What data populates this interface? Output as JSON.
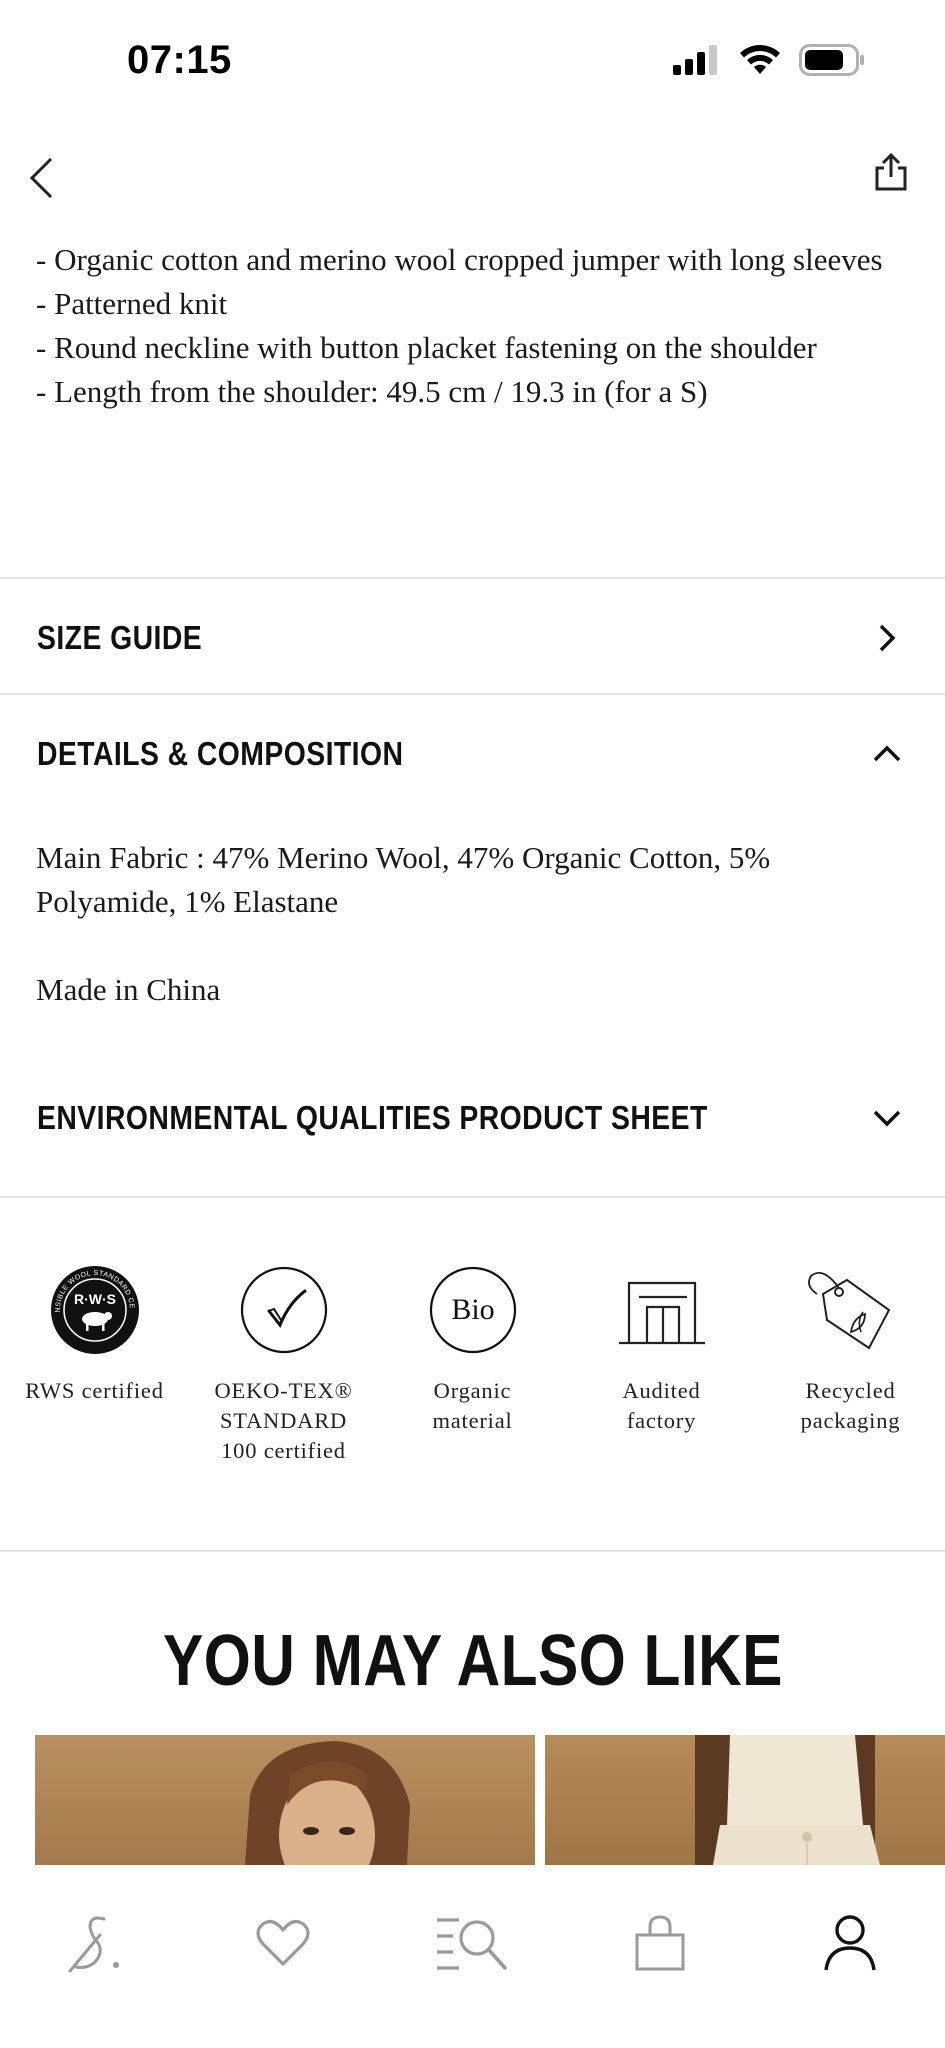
{
  "status_bar": {
    "time": "07:15",
    "icons": [
      "signal-icon",
      "wifi-icon",
      "battery-icon"
    ]
  },
  "nav": {
    "back_icon": "chevron-left-icon",
    "share_icon": "share-icon"
  },
  "description": {
    "lines": [
      "- Organic cotton and merino wool cropped jumper with long sleeves",
      "- Patterned knit",
      "- Round neckline with button placket fastening on the shoulder",
      "- Length from the shoulder: 49.5 cm / 19.3 in (for a S)"
    ]
  },
  "accordion": {
    "size_guide": "SIZE GUIDE",
    "details": "DETAILS & COMPOSITION",
    "environmental": "ENVIRONMENTAL QUALITIES PRODUCT SHEET"
  },
  "composition": {
    "fabric": "Main Fabric : 47% Merino Wool, 47% Organic Cotton, 5% Polyamide, 1% Elastane",
    "origin": "Made in China"
  },
  "badges": [
    {
      "icon": "rws-badge-icon",
      "label": "RWS certified",
      "emblem_text": "R·W·S",
      "ring_text": "RESPONSIBLE WOOL STANDARD CERTIFIED"
    },
    {
      "icon": "checkmark-circle-icon",
      "label": "OEKO-TEX®\nSTANDARD\n100 certified"
    },
    {
      "icon": "bio-circle-icon",
      "label": "Organic\nmaterial",
      "emblem_text": "Bio"
    },
    {
      "icon": "factory-icon",
      "label": "Audited\nfactory"
    },
    {
      "icon": "recycled-tag-icon",
      "label": "Recycled\npackaging"
    }
  ],
  "recommendations": {
    "title": "YOU MAY ALSO LIKE"
  },
  "tab_bar": {
    "tabs": [
      {
        "name": "home",
        "icon": "brand-logo-icon"
      },
      {
        "name": "wishlist",
        "icon": "heart-icon"
      },
      {
        "name": "search",
        "icon": "search-menu-icon"
      },
      {
        "name": "bag",
        "icon": "shopping-bag-icon"
      },
      {
        "name": "account",
        "icon": "user-icon",
        "active": true
      }
    ]
  },
  "colors": {
    "text": "#1a1a1a",
    "divider": "#e3e3e3",
    "inactive_icon": "#9a9a9a",
    "active_icon": "#111111"
  }
}
